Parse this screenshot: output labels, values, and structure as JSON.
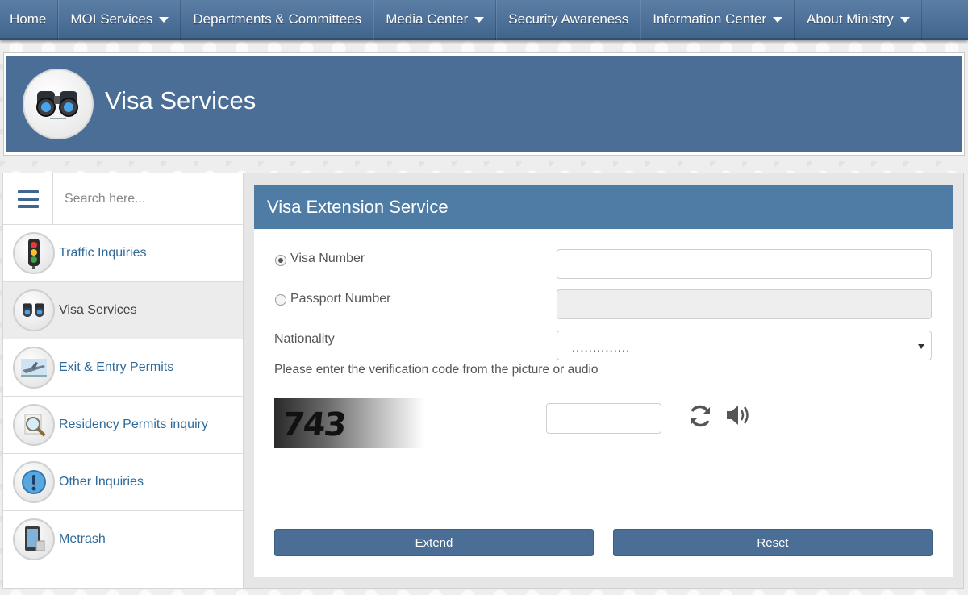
{
  "nav": {
    "items": [
      {
        "label": "Home",
        "has_dropdown": false
      },
      {
        "label": "MOI Services",
        "has_dropdown": true
      },
      {
        "label": "Departments & Committees",
        "has_dropdown": false
      },
      {
        "label": "Media Center",
        "has_dropdown": true
      },
      {
        "label": "Security Awareness",
        "has_dropdown": false
      },
      {
        "label": "Information Center",
        "has_dropdown": true
      },
      {
        "label": "About Ministry",
        "has_dropdown": true
      }
    ]
  },
  "banner": {
    "title": "Visa Services",
    "icon": "binoculars-icon"
  },
  "sidebar": {
    "search_placeholder": "Search here...",
    "items": [
      {
        "label": "Traffic Inquiries",
        "icon": "traffic-light-icon",
        "active": false
      },
      {
        "label": "Visa Services",
        "icon": "binoculars-icon",
        "active": true
      },
      {
        "label": "Exit & Entry Permits",
        "icon": "airplane-icon",
        "active": false
      },
      {
        "label": "Residency Permits inquiry",
        "icon": "magnifier-icon",
        "active": false
      },
      {
        "label": "Other Inquiries",
        "icon": "exclamation-icon",
        "active": false
      },
      {
        "label": "Metrash",
        "icon": "phone-icon",
        "active": false
      }
    ]
  },
  "form": {
    "title": "Visa Extension Service",
    "visa_number_label": "Visa Number",
    "visa_number_value": "",
    "passport_number_label": "Passport Number",
    "passport_number_value": "",
    "nationality_label": "Nationality",
    "nationality_value": "..............",
    "verification_prompt": "Please enter the verification code from the picture or audio",
    "captcha_text": "743",
    "captcha_input_value": "",
    "extend_label": "Extend",
    "reset_label": "Reset"
  },
  "colors": {
    "nav_bg": "#4a6e96",
    "banner_bg": "#4a6e96",
    "panel_header_bg": "#4f7ca5",
    "link": "#2f6a99"
  }
}
